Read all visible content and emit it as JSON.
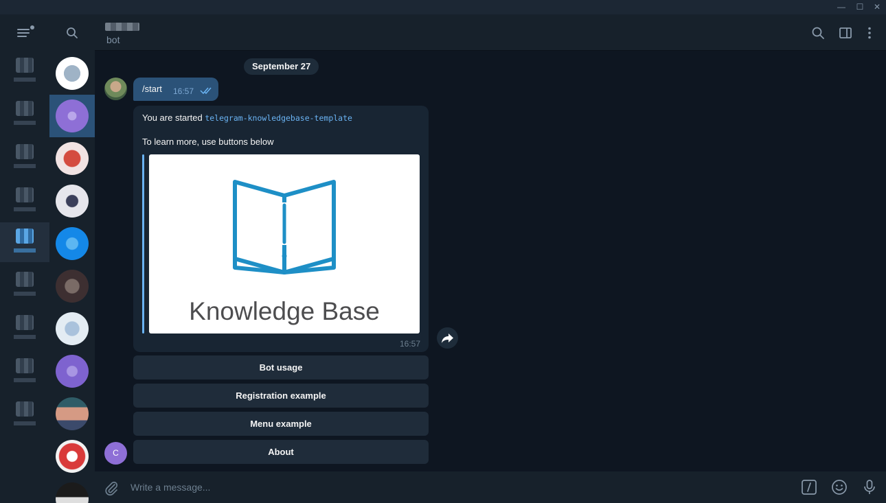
{
  "header": {
    "status": "bot"
  },
  "messages": {
    "date": "September 27",
    "outgoing": {
      "text": "/start",
      "time": "16:57"
    },
    "incoming": {
      "text_prefix": "You are started ",
      "code": "telegram-knowledgebase-template",
      "text_line2": "To learn more, use buttons below",
      "image_title": "Knowledge Base",
      "time": "16:57"
    },
    "buttons": [
      "Bot usage",
      "Registration example",
      "Menu example",
      "About"
    ],
    "bot_avatar_letter": "C"
  },
  "composer": {
    "placeholder": "Write a message..."
  },
  "window_controls": {
    "minimize": "—",
    "maximize": "☐",
    "close": "✕"
  },
  "icons": {
    "menu": "menu-icon",
    "search": "search-icon",
    "sidebar": "sidebar-toggle-icon",
    "more": "more-vertical-icon",
    "attach": "paperclip-icon",
    "command": "slash-command-icon",
    "emoji": "emoji-icon",
    "mic": "microphone-icon",
    "forward": "forward-icon",
    "read": "double-check-icon"
  },
  "colors": {
    "background": "#0e1621",
    "panel": "#17212b",
    "outgoing_bubble": "#2b5278",
    "incoming_bubble": "#182533",
    "accent": "#6ab3f3",
    "logo_blue": "#1e8fc6"
  }
}
